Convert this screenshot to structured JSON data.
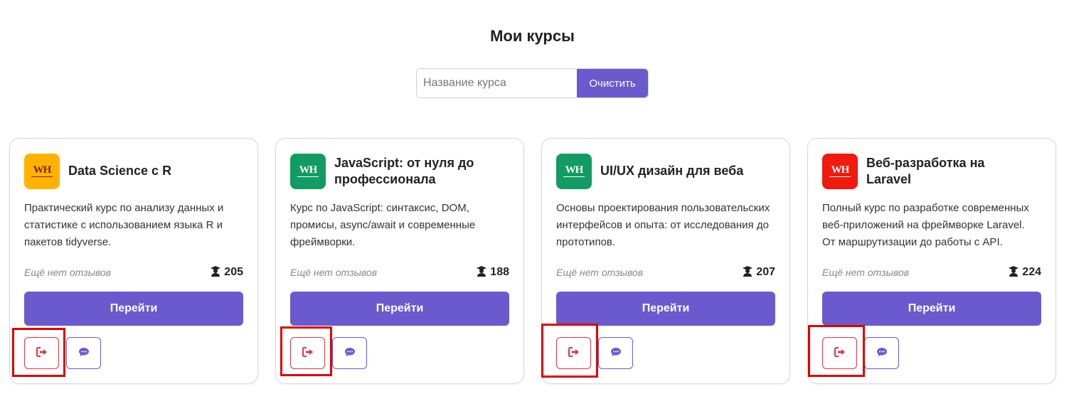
{
  "page": {
    "title": "Мои курсы"
  },
  "search": {
    "placeholder": "Название курса",
    "value": "",
    "clear_label": "Очистить"
  },
  "courses": [
    {
      "logo": {
        "text": "WH",
        "bg": "#ffb300",
        "fg": "#7a1f0a"
      },
      "title_lines": [
        "Data Science с R"
      ],
      "description_lines": [
        "Практический курс по анализу данных и",
        "статистике с использованием языка R и",
        "пакетов tidyverse."
      ],
      "reviews": "Ещё нет отзывов",
      "students": "205",
      "go_label": "Перейти"
    },
    {
      "logo": {
        "text": "WH",
        "bg": "#129c63",
        "fg": "#ffffff"
      },
      "title_lines": [
        "JavaScript: от нуля до",
        "профессионала"
      ],
      "description_lines": [
        "Курс по JavaScript: синтаксис, DOM,",
        "промисы, async/await и современные",
        "фреймворки."
      ],
      "reviews": "Ещё нет отзывов",
      "students": "188",
      "go_label": "Перейти"
    },
    {
      "logo": {
        "text": "WH",
        "bg": "#129c63",
        "fg": "#ffffff"
      },
      "title_lines": [
        "UI/UX дизайн для веба"
      ],
      "description_lines": [
        "Основы проектирования пользовательских",
        "интерфейсов и опыта: от исследования до",
        "прототипов."
      ],
      "reviews": "Ещё нет отзывов",
      "students": "207",
      "go_label": "Перейти"
    },
    {
      "logo": {
        "text": "WH",
        "bg": "#f01a0d",
        "fg": "#ffffff"
      },
      "title_lines": [
        "Веб-разработка на",
        "Laravel"
      ],
      "description_lines": [
        "Полный курс по разработке современных",
        "веб-приложений на фреймворке Laravel.",
        "От маршрутизации до работы с API."
      ],
      "reviews": "Ещё нет отзывов",
      "students": "224",
      "go_label": "Перейти"
    }
  ],
  "icons": {
    "leave": "sign-out-icon",
    "review": "comment-icon",
    "students": "graduate-icon"
  },
  "colors": {
    "accent": "#6a5acd",
    "danger": "#dc3545",
    "highlight": "#e00000"
  }
}
